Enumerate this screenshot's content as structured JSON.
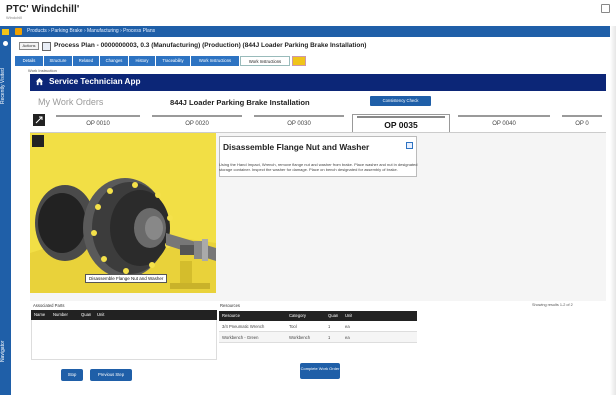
{
  "header": {
    "logo": "PTC' Windchill'",
    "logo_sub": "Windchill"
  },
  "nav": {
    "label_top": "Recently Visited",
    "label_bottom": "Navigator"
  },
  "breadcrumb": {
    "text": "Products › Parking Brake › Manufacturing › Process Plans"
  },
  "title_bar": {
    "actions": "Actions",
    "title": "Process Plan - 0000000003, 0.3 (Manufacturing) (Production) (844J Loader Parking Brake Installation)"
  },
  "tabs": [
    {
      "label": "Details"
    },
    {
      "label": "Structure"
    },
    {
      "label": "Related"
    },
    {
      "label": "Changes"
    },
    {
      "label": "History"
    },
    {
      "label": "Traceability"
    },
    {
      "label": "Work Instructions"
    },
    {
      "label": "Work Instructions"
    }
  ],
  "sub_label": "Work Instruction",
  "app_bar": {
    "title": "Service Technician App"
  },
  "work_order": {
    "my_orders": "My Work Orders",
    "title": "844J Loader Parking Brake Installation",
    "consistency_button": "Consistency Check"
  },
  "operations": [
    {
      "label": "OP 0010"
    },
    {
      "label": "OP 0020"
    },
    {
      "label": "OP 0030"
    },
    {
      "label": "OP 0035"
    },
    {
      "label": "OP 0040"
    },
    {
      "label": "OP 0"
    }
  ],
  "viewer": {
    "caption": "Disassemble Flange Nut and Washer"
  },
  "instruction": {
    "title": "Disassemble Flange Nut and Washer",
    "text": "Using the Hand Impact, Wrench, remove flange nut and washer from brake. Place washer and nut in designated storage container. Inspect the washer for damage. Place on bench designated for assembly of brake."
  },
  "left_table": {
    "label": "Associated Parts",
    "headers": [
      "Name",
      "Number",
      "Quan",
      "Unit"
    ]
  },
  "right_table": {
    "label": "Resources",
    "caption": "Showing results 1-2 of 2",
    "headers": [
      "Resource",
      "Category",
      "Quan",
      "Unit"
    ],
    "rows": [
      [
        "3/4 Pneumatic Wrench",
        "Tool",
        "1",
        "ea"
      ],
      [
        "Workbench - Green",
        "Workbench",
        "1",
        "ea"
      ]
    ]
  },
  "buttons": {
    "stop": "Stop",
    "previous": "Previous Step",
    "complete": "Complete Work Order"
  },
  "colors": {
    "app_bar": "#0c2677",
    "accent_blue": "#1f5fa8",
    "viewer_bg": "#f4e14a"
  }
}
